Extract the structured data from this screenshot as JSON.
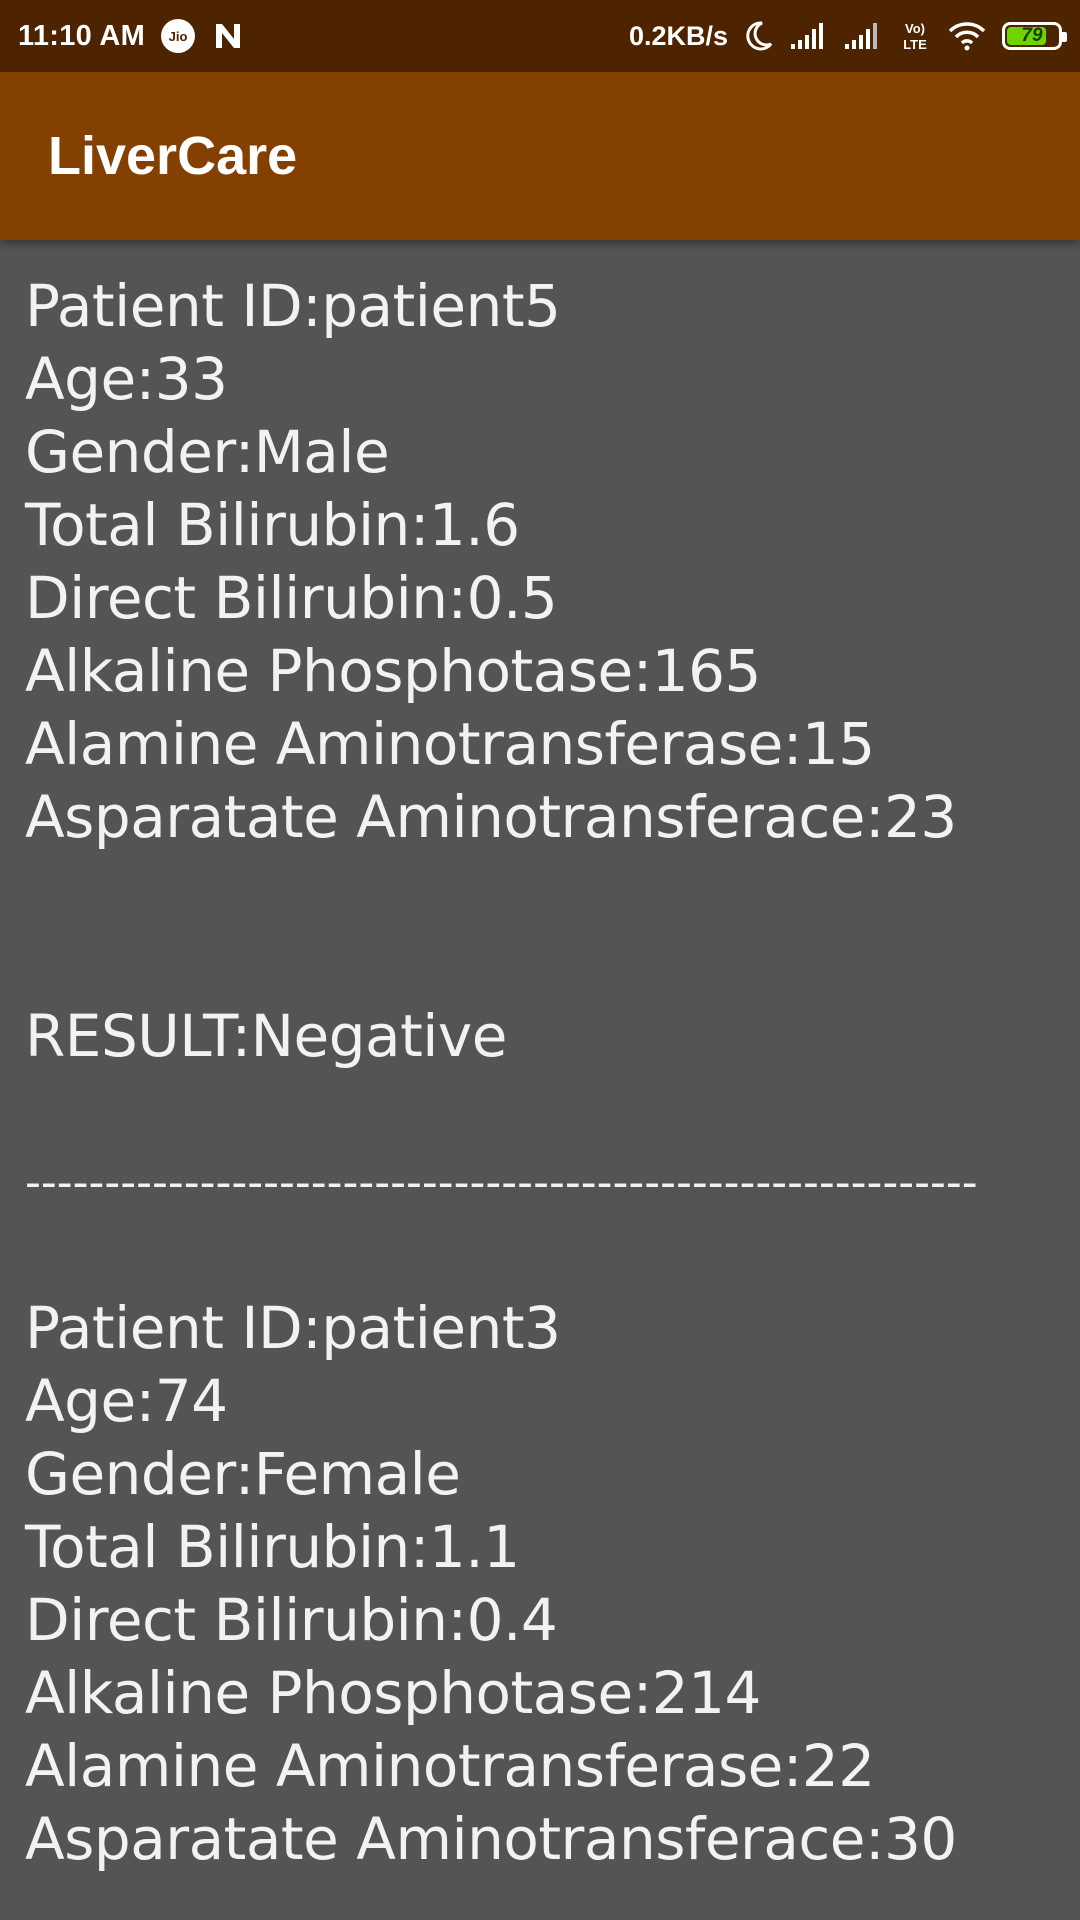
{
  "status_bar": {
    "time": "11:10 AM",
    "carrier_badge": "Jio",
    "network_speed": "0.2KB/s",
    "volte_label": "Vo) LTE",
    "battery_level": "79",
    "battery_fraction": 0.79,
    "icons": [
      "jio-icon",
      "n-notification-icon",
      "moon-icon",
      "signal-icon",
      "signal-icon",
      "volte-icon",
      "wifi-icon",
      "battery-icon"
    ]
  },
  "app_bar": {
    "title": "LiverCare"
  },
  "records": [
    {
      "patient_id": "Patient ID:patient5",
      "age": "Age:33",
      "gender": "Gender:Male",
      "total_bilirubin": "Total Bilirubin:1.6",
      "direct_bilirubin": "Direct Bilirubin:0.5",
      "alkaline_phosphotase": "Alkaline Phosphotase:165",
      "alamine_aminotransferase": "Alamine Aminotransferase:15",
      "asparatate_aminotransferace": "Asparatate Aminotransferace:23",
      "result": "RESULT:Negative",
      "separator": "------------------------------------------------------------"
    },
    {
      "patient_id": "Patient ID:patient3",
      "age": "Age:74",
      "gender": "Gender:Female",
      "total_bilirubin": "Total Bilirubin:1.1",
      "direct_bilirubin": "Direct Bilirubin:0.4",
      "alkaline_phosphotase": "Alkaline Phosphotase:214",
      "alamine_aminotransferase": "Alamine Aminotransferase:22",
      "asparatate_aminotransferace": "Asparatate Aminotransferace:30"
    }
  ],
  "colors": {
    "status_bar": "#4e2300",
    "app_bar": "#834000",
    "background": "#545454",
    "text": "#f2f2f2",
    "battery": "#6dd400"
  }
}
